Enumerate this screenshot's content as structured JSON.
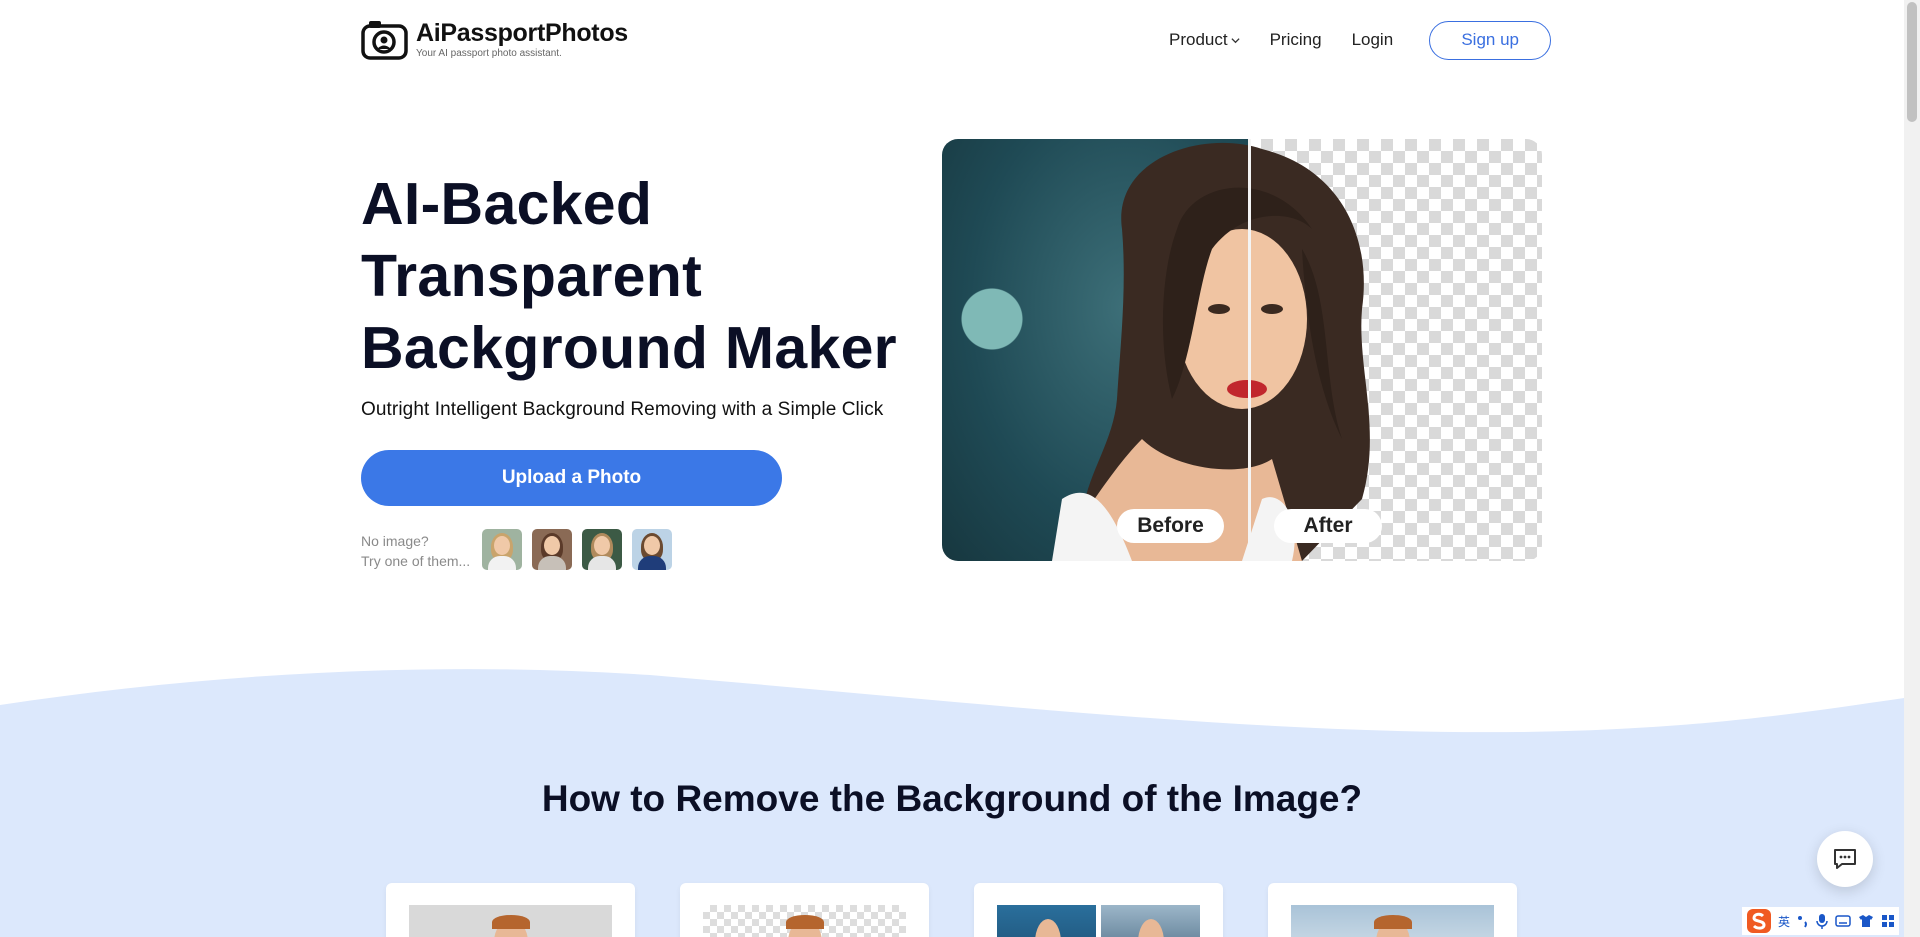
{
  "header": {
    "logo_name": "AiPassportPhotos",
    "logo_tagline": "Your AI passport photo assistant.",
    "nav": {
      "product": "Product",
      "pricing": "Pricing",
      "login": "Login",
      "signup": "Sign up"
    }
  },
  "hero": {
    "title": "AI-Backed Transparent Background Maker",
    "subtitle": "Outright Intelligent Background Removing with a Simple Click",
    "upload_button": "Upload a Photo",
    "try_line1": "No image?",
    "try_line2": "Try one of them...",
    "samples": [
      {
        "name": "sample-woman-blonde",
        "hair": "#c9a46c",
        "body": "#f2f2f2",
        "bg": "#9fb3a0"
      },
      {
        "name": "sample-woman-brown",
        "hair": "#5b3a29",
        "body": "#c7c0b8",
        "bg": "#8a6a55"
      },
      {
        "name": "sample-woman-light",
        "hair": "#b08a5c",
        "body": "#e6e6e6",
        "bg": "#3c5a45"
      },
      {
        "name": "sample-man",
        "hair": "#6b4a30",
        "body": "#1f3d7a",
        "bg": "#bcd3e6"
      }
    ]
  },
  "comparison": {
    "before_label": "Before",
    "after_label": "After"
  },
  "how_to": {
    "title": "How to Remove the Background of the Image?"
  },
  "ime": {
    "lang": "英"
  },
  "colors": {
    "accent": "#3b78e7",
    "section_bg": "#dce8fc",
    "text_dark": "#0b0f25"
  }
}
